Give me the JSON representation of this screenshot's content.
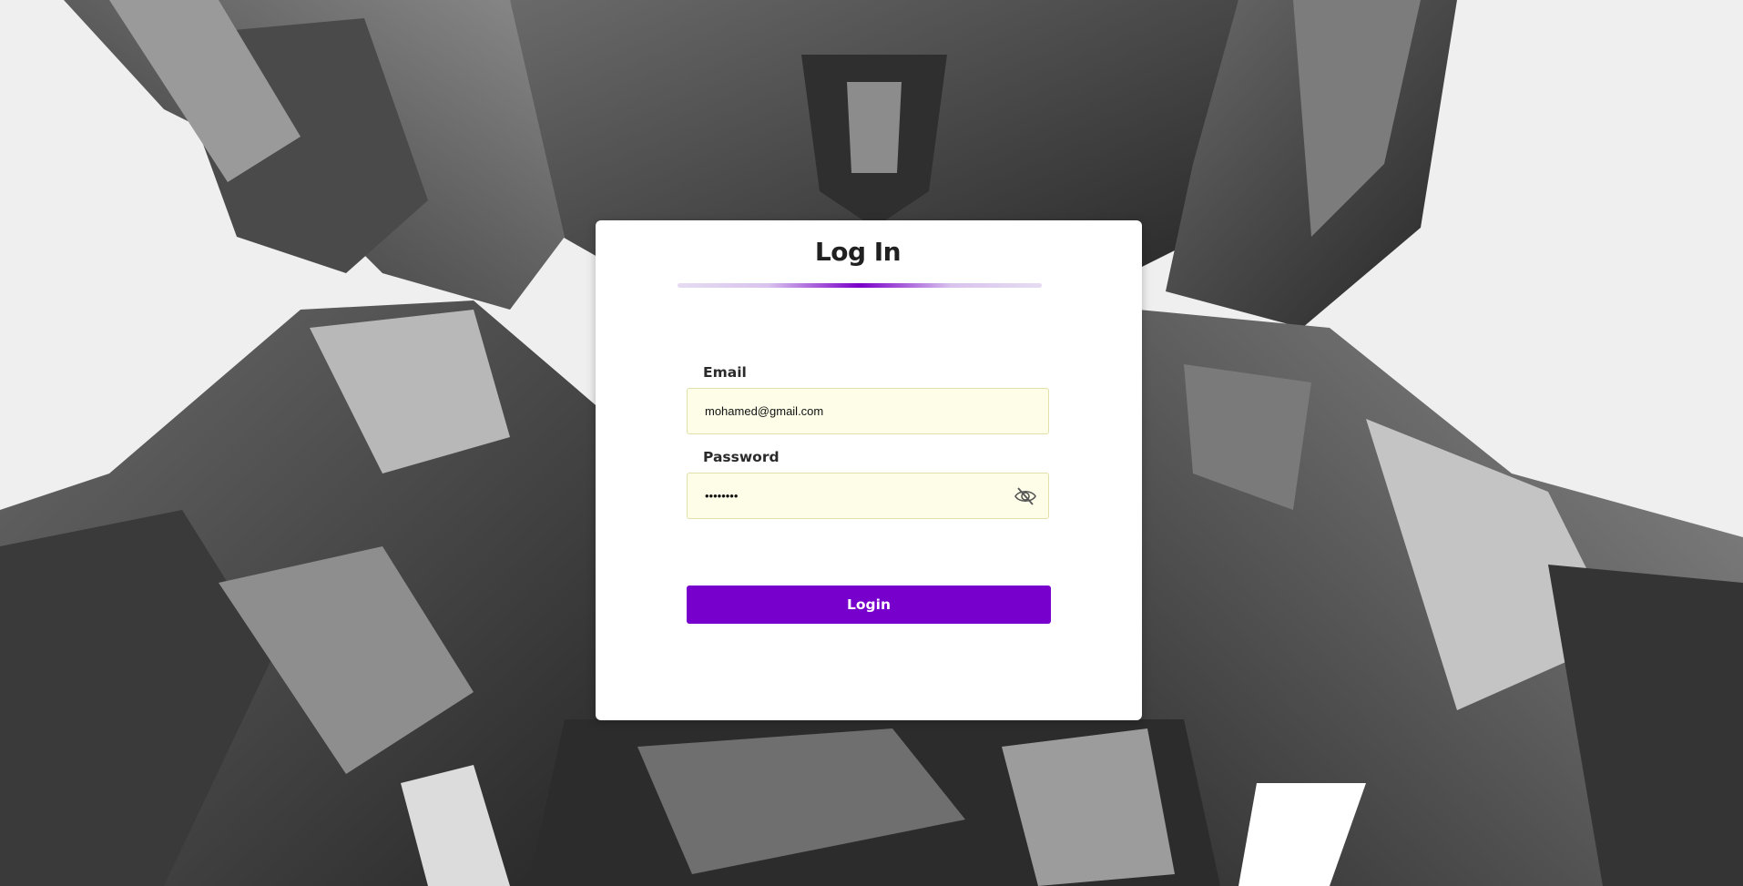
{
  "login": {
    "title": "Log In",
    "email_label": "Email",
    "email_value": "mohamed@gmail.com",
    "password_label": "Password",
    "password_value": "••••••••",
    "password_visibility_icon": "eye-slash-icon",
    "submit_label": "Login"
  },
  "colors": {
    "accent": "#7700cc",
    "input_background": "#fefee8",
    "page_background": "#efefef"
  }
}
